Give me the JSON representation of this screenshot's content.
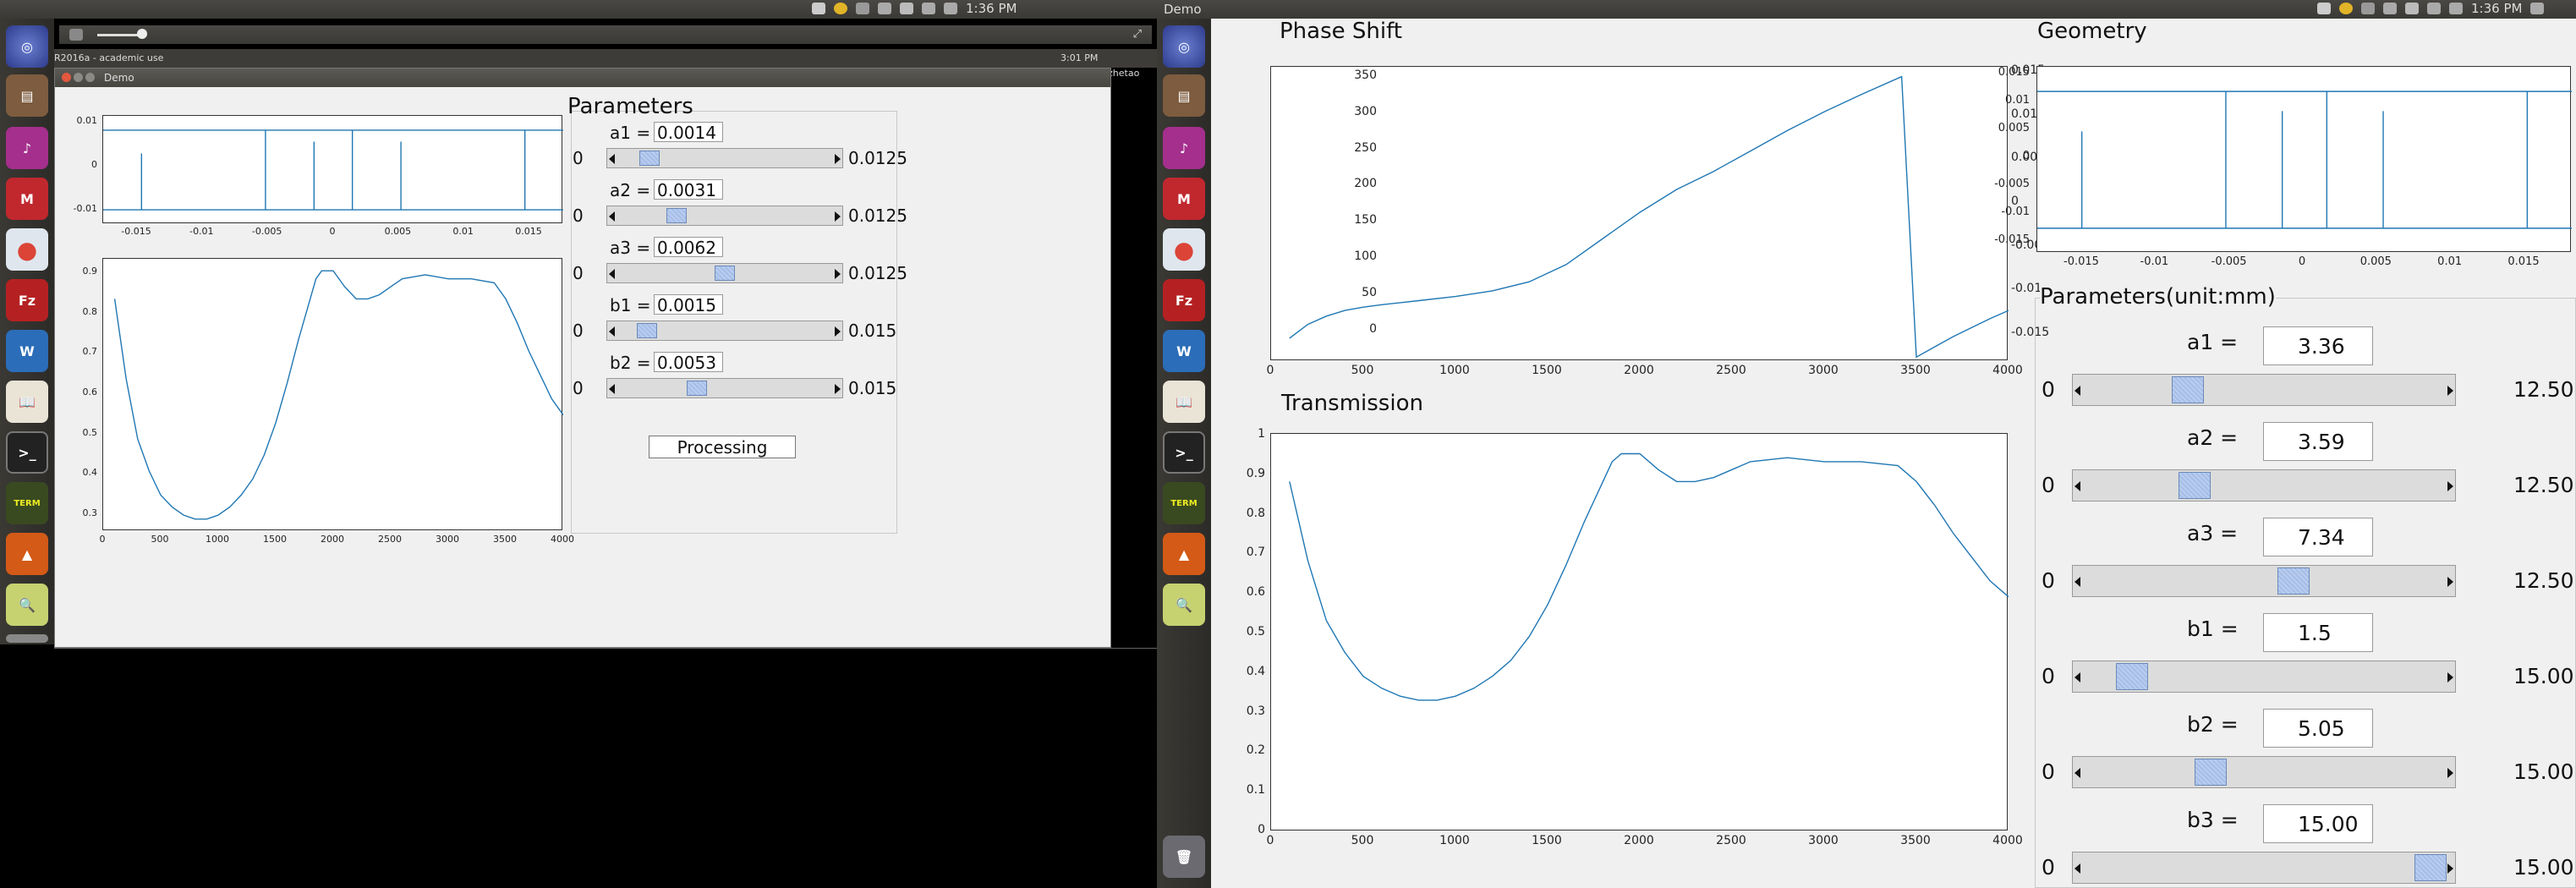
{
  "left_screen": {
    "topbar_time": "1:36 PM",
    "topbar_user": "Demo",
    "inner_clock": "3:01 PM",
    "inner_user": "zhetao",
    "matlab_title": "R2016a - academic use",
    "window_title": "Demo",
    "params_title": "Parameters",
    "rows": [
      {
        "label": "a1 =",
        "value": "0.0014",
        "min": "0",
        "max": "0.0125",
        "fraction": 0.112
      },
      {
        "label": "a2 =",
        "value": "0.0031",
        "min": "0",
        "max": "0.0125",
        "fraction": 0.248
      },
      {
        "label": "a3 =",
        "value": "0.0062",
        "min": "0",
        "max": "0.0125",
        "fraction": 0.496
      },
      {
        "label": "b1 =",
        "value": "0.0015",
        "min": "0",
        "max": "0.015",
        "fraction": 0.1
      },
      {
        "label": "b2 =",
        "value": "0.0053",
        "min": "0",
        "max": "0.015",
        "fraction": 0.353
      }
    ],
    "button": "Processing",
    "geometry_x_ticks": [
      "-0.015",
      "-0.01",
      "-0.005",
      "0",
      "0.005",
      "0.01",
      "0.015"
    ],
    "geometry_y_ticks": [
      "0.01",
      "0",
      "-0.01"
    ],
    "trans_x_ticks": [
      "0",
      "500",
      "1000",
      "1500",
      "2000",
      "2500",
      "3000",
      "3500",
      "4000"
    ],
    "trans_y_ticks": [
      "0.9",
      "0.8",
      "0.7",
      "0.6",
      "0.5",
      "0.4",
      "0.3"
    ]
  },
  "right_screen": {
    "topbar_time": "1:36 PM",
    "phase_title": "Phase Shift",
    "trans_title": "Transmission",
    "geom_title": "Geometry",
    "params_title": "Parameters(unit:mm)",
    "phase_y_ticks": [
      "350",
      "300",
      "250",
      "200",
      "150",
      "100",
      "50",
      "0"
    ],
    "phase_x_ticks": [
      "0",
      "500",
      "1000",
      "1500",
      "2000",
      "2500",
      "3000",
      "3500",
      "4000"
    ],
    "phase_right_ticks": [
      "0.015",
      "0.01",
      "0.005",
      "0",
      "-0.005",
      "-0.01",
      "-0.015"
    ],
    "trans_y_ticks": [
      "1",
      "0.9",
      "0.8",
      "0.7",
      "0.6",
      "0.5",
      "0.4",
      "0.3",
      "0.2",
      "0.1",
      "0"
    ],
    "trans_x_ticks": [
      "0",
      "500",
      "1000",
      "1500",
      "2000",
      "2500",
      "3000",
      "3500",
      "4000"
    ],
    "geom_y_ticks": [
      "0.015",
      "0.01",
      "0.005",
      "0",
      "-0.005",
      "-0.01",
      "-0.015"
    ],
    "geom_x_ticks": [
      "-0.015",
      "-0.01",
      "-0.005",
      "0",
      "0.005",
      "0.01",
      "0.015"
    ],
    "rows": [
      {
        "label": "a1 =",
        "value": "3.36",
        "min": "0",
        "max": "12.50",
        "fraction": 0.269
      },
      {
        "label": "a2 =",
        "value": "3.59",
        "min": "0",
        "max": "12.50",
        "fraction": 0.287
      },
      {
        "label": "a3 =",
        "value": "7.34",
        "min": "0",
        "max": "12.50",
        "fraction": 0.587
      },
      {
        "label": "b1 =",
        "value": "1.5",
        "min": "0",
        "max": "15.00",
        "fraction": 0.1
      },
      {
        "label": "b2 =",
        "value": "5.05",
        "min": "0",
        "max": "15.00",
        "fraction": 0.337
      },
      {
        "label": "b3 =",
        "value": "15.00",
        "min": "0",
        "max": "15.00",
        "fraction": 1.0
      }
    ]
  },
  "chart_data": [
    {
      "type": "line",
      "title": "Phase Shift",
      "x": [
        100,
        200,
        300,
        400,
        500,
        600,
        800,
        1000,
        1200,
        1400,
        1600,
        1800,
        2000,
        2200,
        2400,
        2600,
        2800,
        3000,
        3200,
        3420,
        3500,
        3700,
        3900,
        4000
      ],
      "y": [
        28,
        45,
        55,
        62,
        66,
        69,
        74,
        79,
        86,
        97,
        118,
        150,
        182,
        210,
        232,
        257,
        282,
        305,
        326,
        348,
        5,
        30,
        52,
        62
      ],
      "xlim": [
        0,
        4000
      ],
      "ylim": [
        0,
        360
      ],
      "y2_ticks": [
        0.015,
        0.01,
        0.005,
        0,
        -0.005,
        -0.01,
        -0.015
      ]
    },
    {
      "type": "line",
      "title": "Transmission",
      "x": [
        100,
        200,
        300,
        400,
        500,
        600,
        700,
        800,
        900,
        1000,
        1100,
        1200,
        1300,
        1400,
        1500,
        1600,
        1700,
        1800,
        1850,
        1900,
        2000,
        2100,
        2200,
        2300,
        2400,
        2500,
        2600,
        2800,
        3000,
        3200,
        3400,
        3500,
        3600,
        3700,
        3800,
        3900,
        4000
      ],
      "y": [
        0.88,
        0.68,
        0.53,
        0.45,
        0.39,
        0.36,
        0.34,
        0.33,
        0.33,
        0.34,
        0.36,
        0.39,
        0.43,
        0.49,
        0.57,
        0.67,
        0.78,
        0.88,
        0.93,
        0.95,
        0.95,
        0.91,
        0.88,
        0.88,
        0.89,
        0.91,
        0.93,
        0.94,
        0.93,
        0.93,
        0.92,
        0.88,
        0.82,
        0.75,
        0.69,
        0.63,
        0.59
      ],
      "xlim": [
        0,
        4000
      ],
      "ylim": [
        0,
        1
      ]
    },
    {
      "type": "line",
      "title": "Geometry",
      "xlim": [
        -0.018,
        0.018
      ],
      "ylim": [
        -0.017,
        0.017
      ],
      "boundary_y": [
        0.0125,
        -0.0125
      ],
      "segments": [
        {
          "x": -0.015,
          "y1": -0.0125,
          "y2": 0.0052
        },
        {
          "x": -0.0053,
          "y1": -0.0125,
          "y2": 0.0125
        },
        {
          "x": -0.0015,
          "y1": -0.0125,
          "y2": 0.0089
        },
        {
          "x": 0.0015,
          "y1": -0.0125,
          "y2": 0.0125
        },
        {
          "x": 0.0053,
          "y1": -0.0125,
          "y2": 0.0089
        },
        {
          "x": 0.015,
          "y1": -0.0125,
          "y2": 0.0125
        }
      ]
    }
  ]
}
